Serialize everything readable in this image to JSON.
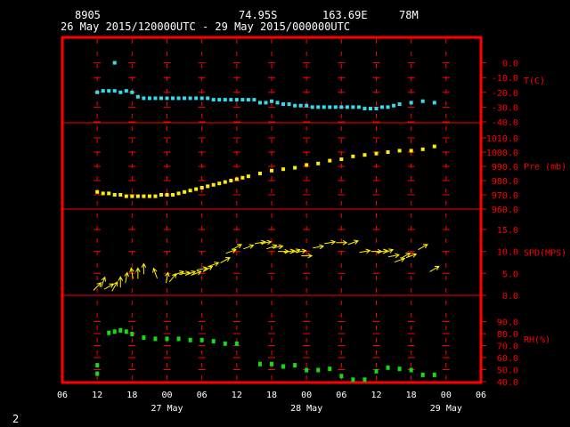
{
  "header": {
    "station_id": "8905",
    "lat": "74.95S",
    "lon": "163.69E",
    "elev": "78M",
    "period": "26 May 2015/120000UTC - 29 May 2015/000000UTC"
  },
  "footer": {
    "page_number": "2"
  },
  "colors": {
    "frame": "#ff0000",
    "axis_text": "#ff0000",
    "tick_text": "#ffffff",
    "temperature": "#33ddee",
    "pressure": "#ffee00",
    "wind": "#ffee00",
    "humidity": "#11dd11"
  },
  "chart_data": [
    {
      "type": "scatter",
      "panel": "temperature",
      "ylabel": "T(C)",
      "ylim": [
        -40,
        10
      ],
      "yticks": [
        0,
        -10,
        -20,
        -30,
        -40
      ],
      "ytick_labels": [
        "0.0",
        "-10.0",
        "-20.0",
        "-30.0",
        "-40.0"
      ],
      "x_hours": [
        12,
        13,
        14,
        15,
        16,
        17,
        18,
        19,
        20,
        21,
        22,
        23,
        24,
        25,
        26,
        27,
        28,
        29,
        30,
        31,
        32,
        33,
        34,
        35,
        36,
        37,
        38,
        39,
        40,
        41,
        42,
        43,
        44,
        45,
        46,
        47,
        48,
        49,
        50,
        51,
        52,
        53,
        54,
        55,
        56,
        57,
        58,
        59,
        60,
        61,
        62,
        63,
        64,
        66,
        68,
        70
      ],
      "values": [
        -20,
        -19,
        -19,
        -19,
        -20,
        -19,
        -20,
        -23,
        -24,
        -24,
        -24,
        -24,
        -24,
        -24,
        -24,
        -24,
        -24,
        -24,
        -24,
        -24,
        -25,
        -25,
        -25,
        -25,
        -25,
        -25,
        -25,
        -25,
        -27,
        -27,
        -26,
        -27,
        -28,
        -28,
        -29,
        -29,
        -29,
        -30,
        -30,
        -30,
        -30,
        -30,
        -30,
        -30,
        -30,
        -30,
        -31,
        -31,
        -31,
        -30,
        -30,
        -29,
        -28,
        -27,
        -26,
        -27
      ],
      "outlier": {
        "x_hour": 15,
        "value": 0
      }
    },
    {
      "type": "scatter",
      "panel": "pressure",
      "ylabel": "Pre (mb)",
      "ylim": [
        960,
        1010
      ],
      "yticks": [
        1010,
        1000,
        990,
        980,
        970,
        960
      ],
      "ytick_labels": [
        "1010.0",
        "1000.0",
        "990.0",
        "980.0",
        "970.0",
        "960.0"
      ],
      "x_hours": [
        12,
        13,
        14,
        15,
        16,
        17,
        18,
        19,
        20,
        21,
        22,
        23,
        24,
        25,
        26,
        27,
        28,
        29,
        30,
        31,
        32,
        33,
        34,
        35,
        36,
        37,
        38,
        40,
        42,
        44,
        46,
        48,
        50,
        52,
        54,
        56,
        58,
        60,
        62,
        64,
        66,
        68,
        70
      ],
      "values": [
        972,
        971,
        971,
        970,
        970,
        969,
        969,
        969,
        969,
        969,
        969,
        970,
        970,
        970,
        971,
        972,
        973,
        974,
        975,
        976,
        977,
        978,
        979,
        980,
        981,
        982,
        983,
        985,
        987,
        988,
        989,
        991,
        992,
        994,
        995,
        997,
        998,
        999,
        1000,
        1001,
        1001,
        1002,
        1004
      ]
    },
    {
      "type": "scatter",
      "panel": "wind",
      "ylabel": "SPD(MPS)",
      "ylim": [
        0,
        15
      ],
      "yticks": [
        15,
        10,
        5,
        0
      ],
      "ytick_labels": [
        "15.0",
        "10.0",
        "5.0",
        "0.0"
      ],
      "x_hours": [
        12,
        13,
        14,
        15,
        16,
        17,
        18,
        19,
        20,
        22,
        24,
        25,
        26,
        27,
        28,
        29,
        30,
        31,
        32,
        34,
        35,
        36,
        38,
        40,
        41,
        42,
        43,
        44,
        45,
        46,
        47,
        48,
        50,
        52,
        54,
        56,
        58,
        60,
        61,
        62,
        63,
        64,
        65,
        66,
        68
      ],
      "speeds": [
        2,
        3,
        2,
        2,
        3,
        4,
        5,
        5,
        6,
        5,
        4,
        4,
        5,
        5,
        5,
        5,
        6,
        6,
        7,
        8,
        10,
        11,
        11,
        12,
        12,
        11,
        11,
        10,
        10,
        10,
        10,
        9,
        11,
        12,
        12,
        12,
        10,
        10,
        10,
        10,
        9,
        8,
        9,
        9,
        11
      ],
      "directions_deg": [
        225,
        200,
        240,
        210,
        180,
        190,
        170,
        180,
        180,
        160,
        190,
        220,
        250,
        260,
        250,
        250,
        260,
        240,
        250,
        240,
        250,
        240,
        250,
        260,
        260,
        250,
        260,
        270,
        260,
        250,
        260,
        270,
        260,
        260,
        270,
        250,
        260,
        270,
        260,
        250,
        260,
        250,
        240,
        250,
        240
      ],
      "last": {
        "x_hour": 70,
        "speed": 6,
        "direction_deg": 240
      }
    },
    {
      "type": "scatter",
      "panel": "humidity",
      "ylabel": "RH(%)",
      "ylim": [
        40,
        100
      ],
      "yticks": [
        90,
        80,
        70,
        60,
        50,
        40
      ],
      "ytick_labels": [
        "90.0",
        "80.0",
        "70.0",
        "60.0",
        "50.0",
        "40.0"
      ],
      "x_hours": [
        12,
        14,
        15,
        16,
        17,
        18,
        20,
        22,
        24,
        26,
        28,
        30,
        32,
        34,
        36,
        40,
        42,
        44,
        46,
        48,
        50,
        52,
        54,
        56,
        58,
        60,
        62,
        64,
        66,
        68,
        70
      ],
      "values": [
        54,
        81,
        82,
        83,
        82,
        80,
        77,
        76,
        76,
        76,
        75,
        75,
        74,
        72,
        72,
        55,
        55,
        53,
        54,
        50,
        50,
        51,
        45,
        42,
        42,
        49,
        52,
        51,
        50,
        46,
        46
      ],
      "extra": [
        {
          "x_hour": 12,
          "value": 47
        }
      ]
    }
  ],
  "x_axis": {
    "hour_ticks": [
      "06",
      "12",
      "18",
      "00",
      "06",
      "12",
      "18",
      "00",
      "06",
      "12",
      "18",
      "00",
      "06"
    ],
    "day_labels": [
      "27 May",
      "28 May",
      "29 May"
    ]
  }
}
